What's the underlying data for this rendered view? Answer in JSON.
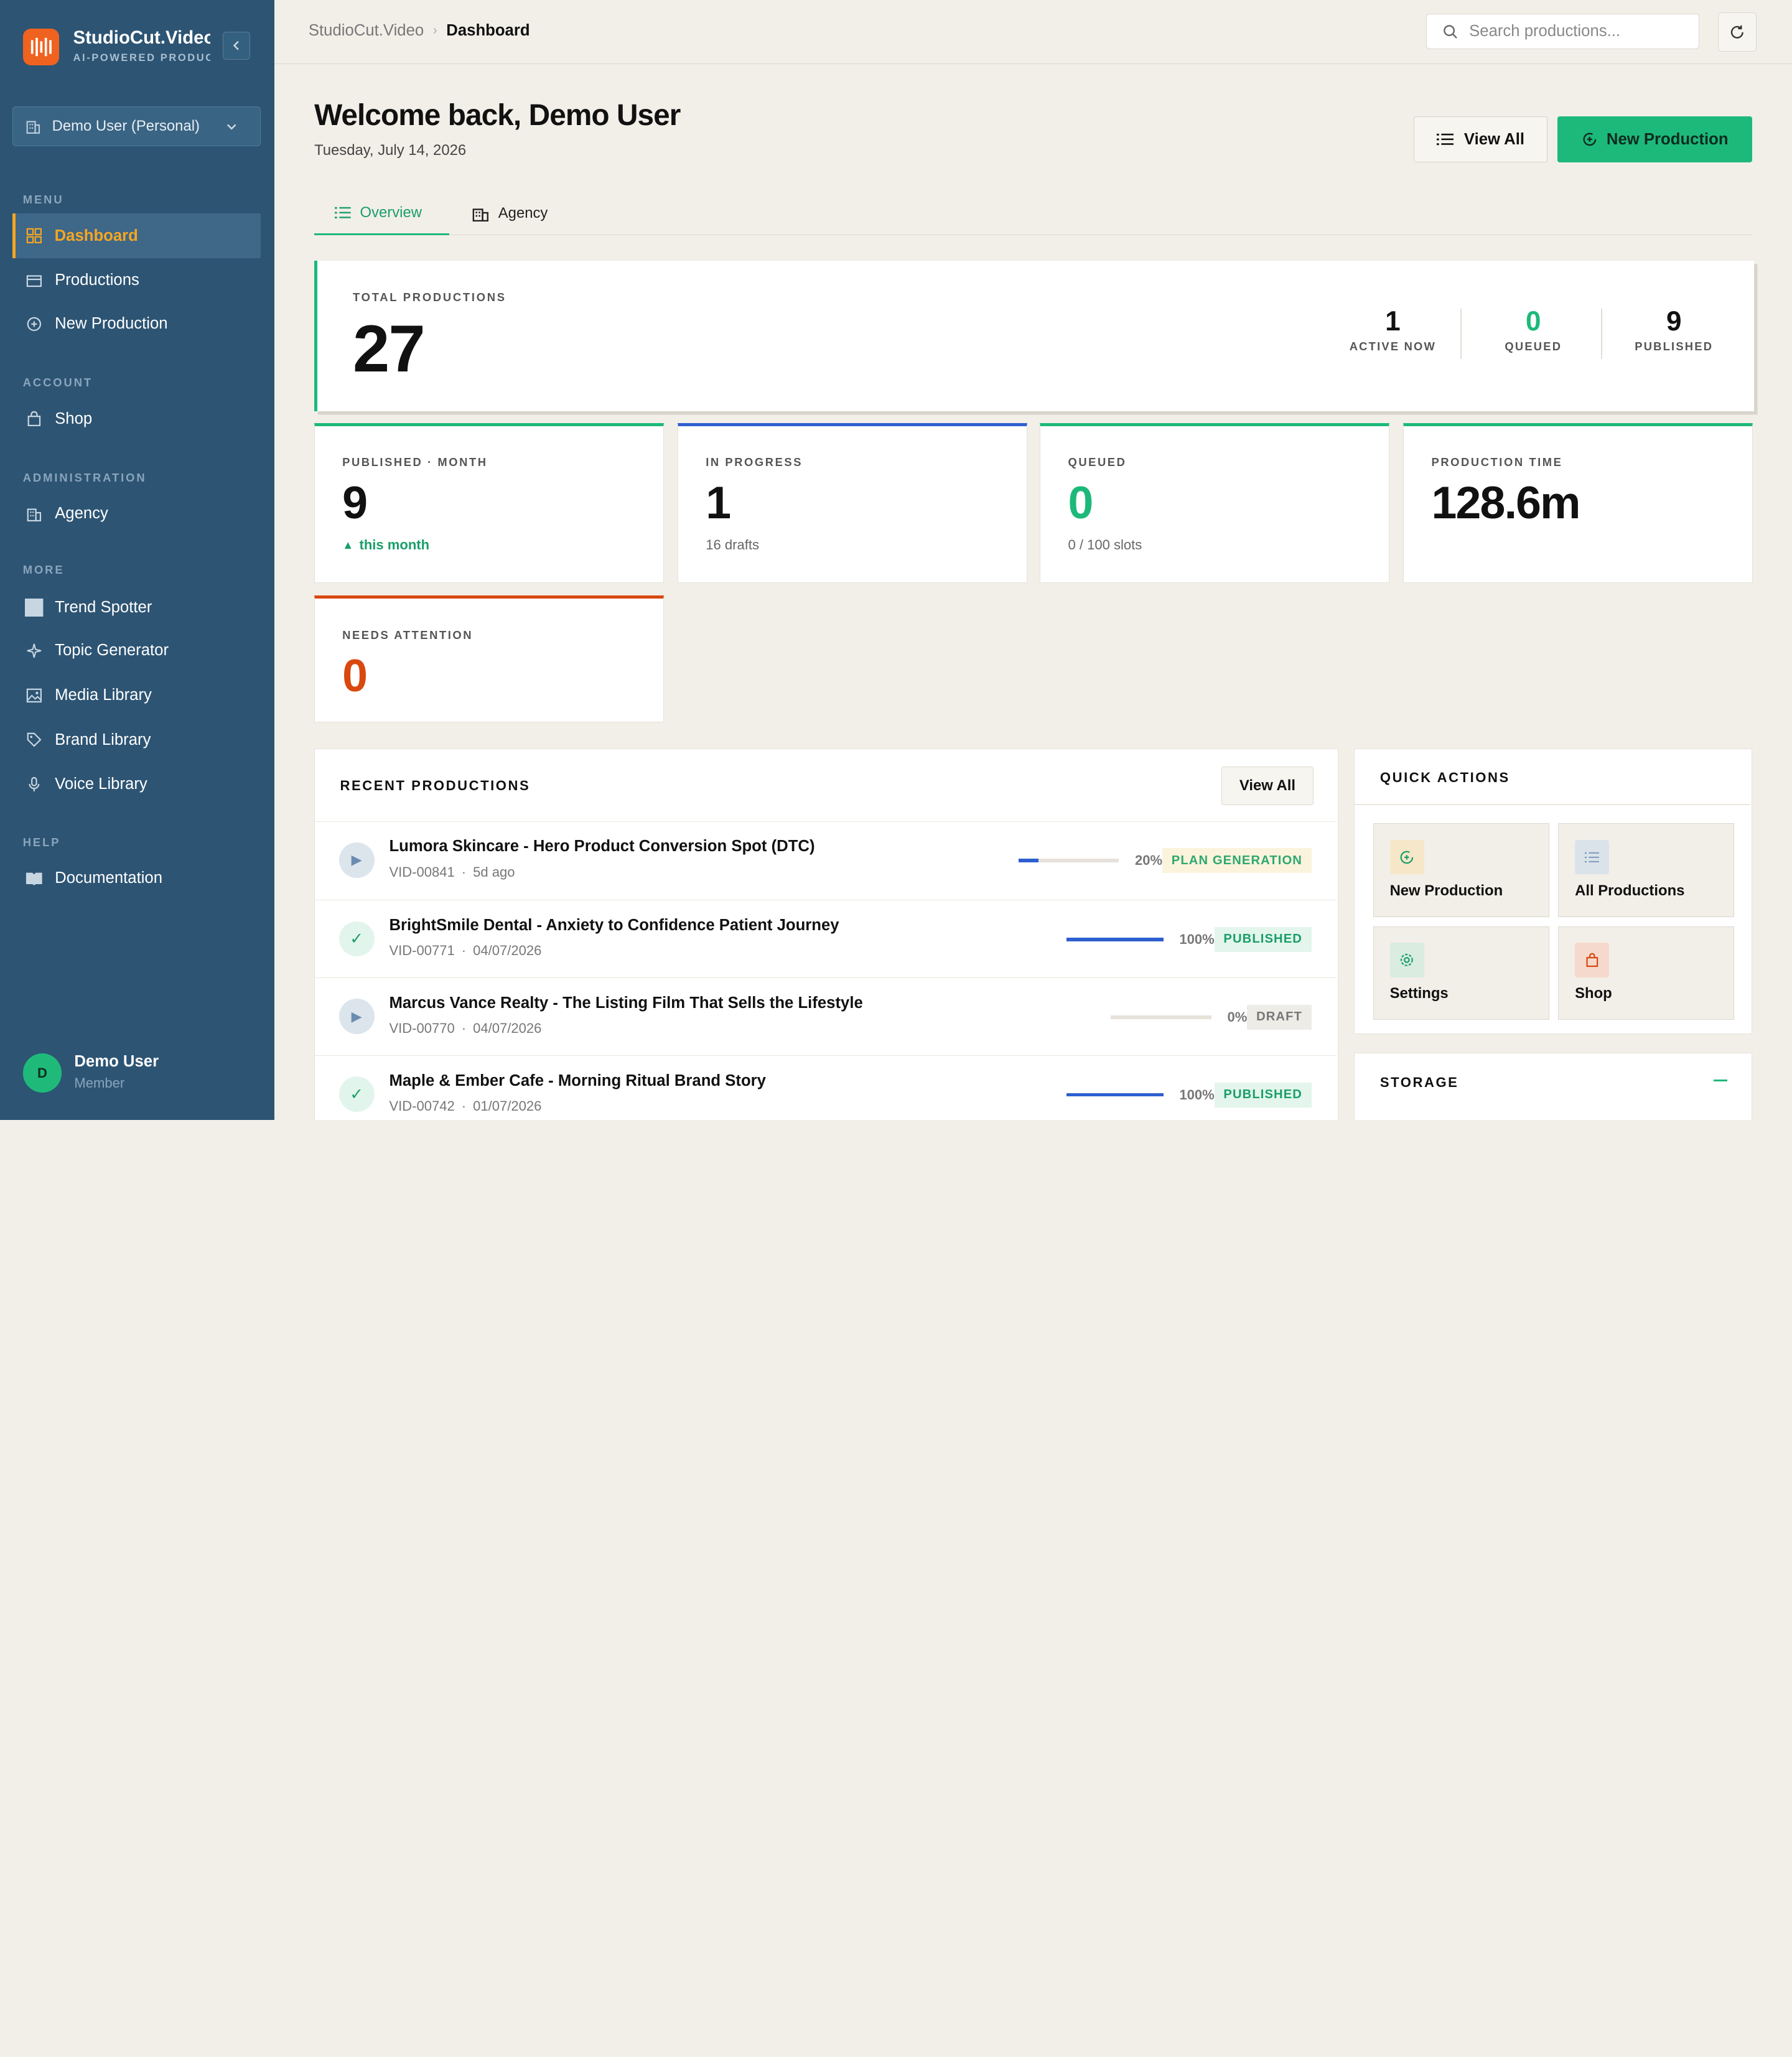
{
  "brand": {
    "name": "StudioCut.Video",
    "tagline": "AI-POWERED PRODUCTION"
  },
  "workspace": {
    "selected": "Demo User (Personal)"
  },
  "sidebar": {
    "sections": {
      "menu": "MENU",
      "account": "ACCOUNT",
      "administration": "ADMINISTRATION",
      "more": "MORE",
      "help": "HELP"
    },
    "items": {
      "dashboard": "Dashboard",
      "productions": "Productions",
      "new_production": "New Production",
      "shop": "Shop",
      "agency": "Agency",
      "trend_spotter": "Trend Spotter",
      "topic_generator": "Topic Generator",
      "media_library": "Media Library",
      "brand_library": "Brand Library",
      "voice_library": "Voice Library",
      "documentation": "Documentation"
    },
    "active_item": "Dashboard"
  },
  "user": {
    "initial": "D",
    "name": "Demo User",
    "role": "Member"
  },
  "breadcrumb": {
    "root": "StudioCut.Video",
    "current": "Dashboard"
  },
  "search": {
    "placeholder": "Search productions..."
  },
  "header": {
    "welcome": "Welcome back, Demo User",
    "date": "Tuesday, July 14, 2026",
    "view_all_label": "View All",
    "new_production_label": "New Production"
  },
  "tabs": {
    "overview": "Overview",
    "agency": "Agency",
    "active": "Overview"
  },
  "hero": {
    "label": "TOTAL PRODUCTIONS",
    "value": "27",
    "stats": [
      {
        "value": "1",
        "label": "ACTIVE NOW"
      },
      {
        "value": "0",
        "label": "QUEUED"
      },
      {
        "value": "9",
        "label": "PUBLISHED"
      }
    ]
  },
  "stats": [
    {
      "label": "PUBLISHED · MONTH",
      "value": "9",
      "sub": "this month",
      "accent": "#1db97a",
      "value_color": "#111111"
    },
    {
      "label": "IN PROGRESS",
      "value": "1",
      "sub": "16 drafts",
      "accent": "#2e5fd0",
      "value_color": "#111111"
    },
    {
      "label": "QUEUED",
      "value": "0",
      "sub": "0 / 100 slots",
      "accent": "#1db97a",
      "value_color": "#1db97a"
    },
    {
      "label": "PRODUCTION TIME",
      "value": "128.6m",
      "sub": "",
      "accent": "#1db97a",
      "value_color": "#111111"
    },
    {
      "label": "NEEDS ATTENTION",
      "value": "0",
      "sub": "",
      "accent": "#d9480f",
      "value_color": "#d9480f"
    }
  ],
  "recent": {
    "title": "RECENT PRODUCTIONS",
    "view_all_label": "View All",
    "rows": [
      {
        "status_icon": "play-icon",
        "title": "Lumora Skincare - Hero Product Conversion Spot (DTC)",
        "id": "VID-00841",
        "when": "5d ago",
        "progress": 20,
        "progress_label": "20%",
        "status": "PLAN GENERATION",
        "status_kind": "gen"
      },
      {
        "status_icon": "check-icon",
        "title": "BrightSmile Dental - Anxiety to Confidence Patient Journey",
        "id": "VID-00771",
        "when": "04/07/2026",
        "progress": 100,
        "progress_label": "100%",
        "status": "PUBLISHED",
        "status_kind": "pub"
      },
      {
        "status_icon": "play-icon",
        "title": "Marcus Vance Realty - The Listing Film That Sells the Lifestyle",
        "id": "VID-00770",
        "when": "04/07/2026",
        "progress": 0,
        "progress_label": "0%",
        "status": "DRAFT",
        "status_kind": "draft"
      },
      {
        "status_icon": "check-icon",
        "title": "Maple & Ember Cafe - Morning Ritual Brand Story",
        "id": "VID-00742",
        "when": "01/07/2026",
        "progress": 100,
        "progress_label": "100%",
        "status": "PUBLISHED",
        "status_kind": "pub"
      }
    ]
  },
  "quick_actions": {
    "title": "QUICK ACTIONS",
    "items": [
      {
        "label": "New Production",
        "icon": "plus-circle-icon"
      },
      {
        "label": "All Productions",
        "icon": "list-icon"
      },
      {
        "label": "Settings",
        "icon": "gear-icon"
      },
      {
        "label": "Shop",
        "icon": "shopping-bag-icon"
      }
    ]
  },
  "storage": {
    "title": "STORAGE"
  }
}
